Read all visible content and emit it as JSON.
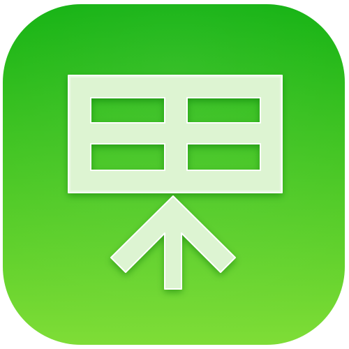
{
  "app_icon": {
    "glyph": "table-upload-icon",
    "colors": {
      "background_top": "#0fb10d",
      "background_bottom": "#7fdd37",
      "glyph_fill": "#ddf4d2",
      "glyph_edge": "#ffffff",
      "glyph_shadow": "#0a7c0a"
    }
  }
}
